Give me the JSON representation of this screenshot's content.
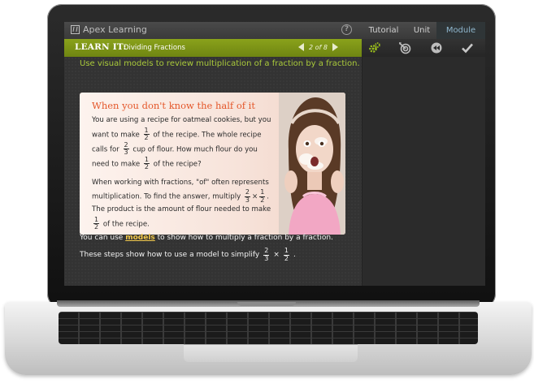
{
  "app": {
    "logo_text": "Apex Learning",
    "help_label": "?",
    "tabs": [
      {
        "label": "Tutorial",
        "active": false
      },
      {
        "label": "Unit",
        "active": false
      },
      {
        "label": "Module",
        "active": true
      }
    ]
  },
  "lesson_bar": {
    "label": "LEARN IT:",
    "title": "Dividing Fractions",
    "page_current": "2",
    "page_of": "of",
    "page_total": "8"
  },
  "tools": [
    "gear-icon",
    "target-icon",
    "back-icon",
    "check-icon"
  ],
  "content": {
    "instruction": "Use visual models to review multiplication of a fraction by a fraction.",
    "card": {
      "heading": "When you don't know the half of it",
      "para1": {
        "t1": "You are using a recipe for oatmeal cookies, but you want to make",
        "f1_num": "1",
        "f1_den": "2",
        "t2": "of the recipe. The whole recipe calls for",
        "f2_num": "2",
        "f2_den": "3",
        "t3": "cup of flour. How much flour do you need to make",
        "f3_num": "1",
        "f3_den": "2",
        "t4": "of the recipe?"
      },
      "para2": {
        "t1": "When working with fractions, \"of\" often represents multiplication. To find the answer, multiply",
        "f1_num": "2",
        "f1_den": "3",
        "times": "×",
        "f2_num": "1",
        "f2_den": "2",
        "t2": ". The product is the amount of flour needed to make",
        "f3_num": "1",
        "f3_den": "2",
        "t3": "of the recipe."
      }
    },
    "line1": {
      "before": "You can use",
      "link": "models",
      "after": "to show how to multiply a fraction by a fraction."
    },
    "line2": {
      "text": "These steps show how to use a model to simplify",
      "f1_num": "2",
      "f1_den": "3",
      "times": "×",
      "f2_num": "1",
      "f2_den": "2",
      "end": "."
    }
  },
  "colors": {
    "accent_green": "#8aa21b",
    "instruction_text": "#a9c93a",
    "heading_orange": "#e4572a",
    "link_yellow": "#f2c94c",
    "module_tab": "#8fb7ce"
  }
}
